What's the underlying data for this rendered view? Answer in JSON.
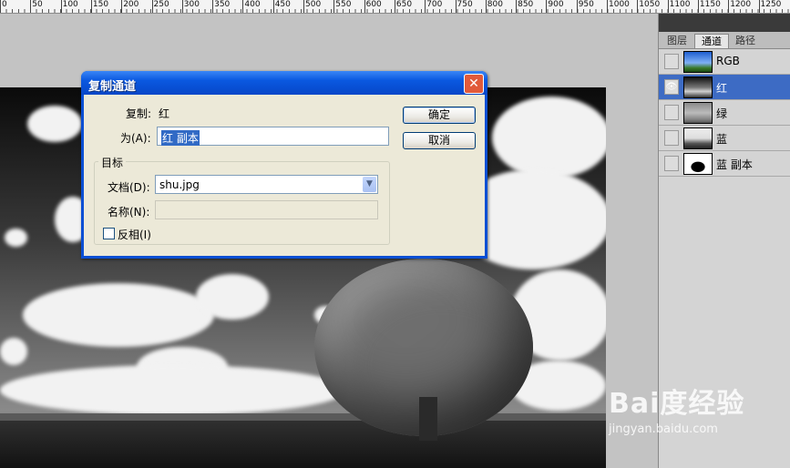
{
  "ruler": {
    "labels": [
      "0",
      "50",
      "100",
      "150",
      "200",
      "250",
      "300",
      "350",
      "400",
      "450",
      "500",
      "550",
      "600",
      "650",
      "700",
      "750",
      "800",
      "850",
      "900",
      "950",
      "1000",
      "1050",
      "1100",
      "1150",
      "1200",
      "1250"
    ]
  },
  "dialog": {
    "title": "复制通道",
    "close_label": "✕",
    "copy_label": "复制:",
    "copy_value": "红",
    "as_label": "为(A):",
    "as_value": "红 副本",
    "ok_label": "确定",
    "cancel_label": "取消",
    "dest_group": "目标",
    "doc_label": "文档(D):",
    "doc_value": "shu.jpg",
    "name_label": "名称(N):",
    "name_value": "",
    "invert_label": "反相(I)",
    "invert_checked": false
  },
  "panel": {
    "tabs": [
      "图层",
      "通道",
      "路径"
    ],
    "active_tab": "通道",
    "channels": [
      {
        "name": "RGB",
        "visible": false,
        "selected": false
      },
      {
        "name": "红",
        "visible": true,
        "selected": true
      },
      {
        "name": "绿",
        "visible": false,
        "selected": false
      },
      {
        "name": "蓝",
        "visible": false,
        "selected": false
      },
      {
        "name": "蓝 副本",
        "visible": false,
        "selected": false
      }
    ],
    "eye_glyph": "👁"
  },
  "watermark": {
    "main": "Bai度经验",
    "sub": "jingyan.baidu.com"
  },
  "colors": {
    "dialog_border": "#0a4fd4",
    "selected_row": "#3d6bc4",
    "close_button": "#e15a3a"
  }
}
